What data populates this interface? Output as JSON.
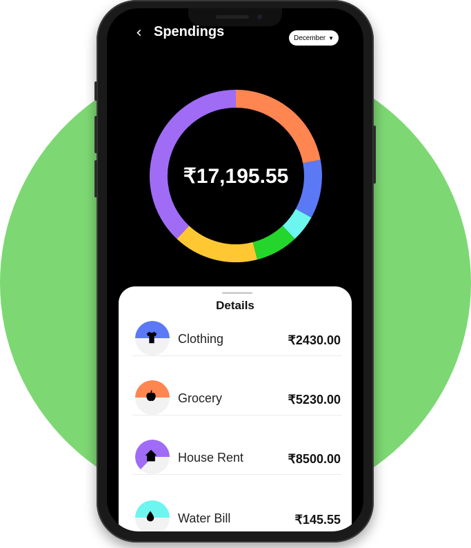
{
  "header": {
    "title": "Spendings",
    "month": "December"
  },
  "summary": {
    "total": "₹17,195.55"
  },
  "details": {
    "title": "Details",
    "items": [
      {
        "label": "Clothing",
        "amount": "₹2430.00",
        "icon": "shirt-icon",
        "color": "#5b79f5"
      },
      {
        "label": "Grocery",
        "amount": "₹5230.00",
        "icon": "apple-icon",
        "color": "#ff8551"
      },
      {
        "label": "House Rent",
        "amount": "₹8500.00",
        "icon": "house-icon",
        "color": "#a06cf6"
      },
      {
        "label": "Water Bill",
        "amount": "₹145.55",
        "icon": "drop-icon",
        "color": "#6df5f0"
      }
    ]
  },
  "chart_data": {
    "type": "pie",
    "categories": [
      "Orange",
      "Blue",
      "Cyan",
      "Green",
      "Yellow",
      "Purple"
    ],
    "values": [
      22,
      11,
      5,
      8,
      16,
      38
    ],
    "colors": [
      "#ff8551",
      "#5b79f5",
      "#6df5f0",
      "#24d62b",
      "#ffc833",
      "#a06cf6"
    ]
  }
}
